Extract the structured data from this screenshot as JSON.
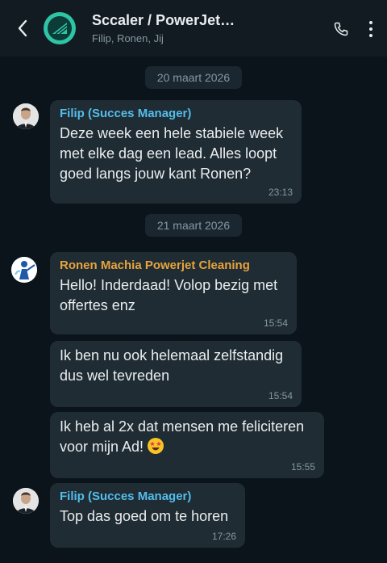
{
  "header": {
    "title": "Sccaler / PowerJet…",
    "subtitle": "Filip, Ronen, Jij",
    "icons": {
      "back": "chevron-left-icon",
      "group_avatar": "sccaler-logo",
      "call": "phone-icon",
      "menu": "more-vertical-icon"
    }
  },
  "dates": [
    "20 maart 2026",
    "21 maart 2026"
  ],
  "messages": [
    {
      "sender": "Filip (Succes Manager)",
      "sender_color": "#53bdeb",
      "text": "Deze week een hele stabiele week met elke dag een lead. Alles loopt goed langs jouw kant Ronen?",
      "time": "23:13"
    },
    {
      "sender": "Ronen Machia Powerjet Cleaning",
      "sender_color": "#e8a33d",
      "text": "Hello! Inderdaad! Volop bezig met offertes enz",
      "time": "15:54"
    },
    {
      "text": "Ik ben nu ook helemaal zelfstandig dus wel tevreden",
      "time": "15:54"
    },
    {
      "text": "Ik heb al 2x dat mensen me feliciteren voor mijn Ad!",
      "emoji": "star-struck-emoji",
      "time": "15:55"
    },
    {
      "sender": "Filip (Succes Manager)",
      "sender_color": "#53bdeb",
      "text": "Top das goed om te horen",
      "time": "17:26"
    }
  ],
  "colors": {
    "background": "#0b141a",
    "header": "#111b21",
    "bubble": "#202c33",
    "muted": "#8696a0"
  }
}
